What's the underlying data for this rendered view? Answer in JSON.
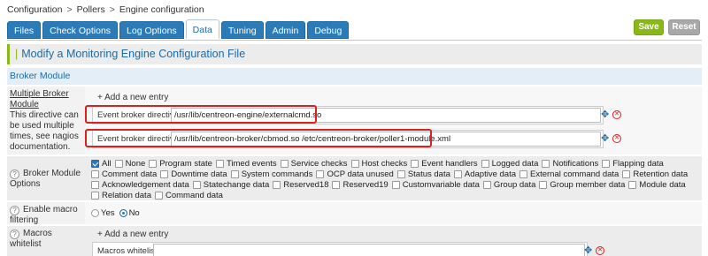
{
  "breadcrumb": [
    "Configuration",
    "Pollers",
    "Engine configuration"
  ],
  "breadcrumb_sep": ">",
  "tabs": [
    {
      "label": "Files",
      "active": false
    },
    {
      "label": "Check Options",
      "active": false
    },
    {
      "label": "Log Options",
      "active": false
    },
    {
      "label": "Data",
      "active": true
    },
    {
      "label": "Tuning",
      "active": false
    },
    {
      "label": "Admin",
      "active": false
    },
    {
      "label": "Debug",
      "active": false
    }
  ],
  "actions": {
    "save": "Save",
    "reset": "Reset"
  },
  "page_title": "Modify a Monitoring Engine Configuration File",
  "section": "Broker Module",
  "broker_module": {
    "label_title": "Multiple Broker Module",
    "label_desc": "This directive can be used multiple times, see nagios documentation.",
    "add_entry": "+ Add a new entry",
    "entries": [
      {
        "label": "Event broker directive",
        "value": "/usr/lib/centreon-engine/externalcmd.so"
      },
      {
        "label": "Event broker directive",
        "value": "/usr/lib/centreon-broker/cbmod.so /etc/centreon-broker/poller1-module.xml"
      }
    ]
  },
  "broker_options": {
    "label": "Broker Module Options",
    "help": "?",
    "lines": [
      [
        {
          "label": "All",
          "checked": true
        },
        {
          "label": "None",
          "checked": false
        },
        {
          "label": "Program state",
          "checked": false
        },
        {
          "label": "Timed events",
          "checked": false
        },
        {
          "label": "Service checks",
          "checked": false
        },
        {
          "label": "Host checks",
          "checked": false
        },
        {
          "label": "Event handlers",
          "checked": false
        },
        {
          "label": "Logged data",
          "checked": false
        },
        {
          "label": "Notifications",
          "checked": false
        },
        {
          "label": "Flapping data",
          "checked": false
        }
      ],
      [
        {
          "label": "Comment data",
          "checked": false
        },
        {
          "label": "Downtime data",
          "checked": false
        },
        {
          "label": "System commands",
          "checked": false
        },
        {
          "label": "OCP data unused",
          "checked": false
        },
        {
          "label": "Status data",
          "checked": false
        },
        {
          "label": "Adaptive data",
          "checked": false
        },
        {
          "label": "External command data",
          "checked": false
        },
        {
          "label": "Retention data",
          "checked": false
        }
      ],
      [
        {
          "label": "Acknowledgement data",
          "checked": false
        },
        {
          "label": "Statechange data",
          "checked": false
        },
        {
          "label": "Reserved18",
          "checked": false
        },
        {
          "label": "Reserved19",
          "checked": false
        },
        {
          "label": "Customvariable data",
          "checked": false
        },
        {
          "label": "Group data",
          "checked": false
        },
        {
          "label": "Group member data",
          "checked": false
        },
        {
          "label": "Module data",
          "checked": false
        }
      ],
      [
        {
          "label": "Relation data",
          "checked": false
        },
        {
          "label": "Command data",
          "checked": false
        }
      ]
    ]
  },
  "macro_filtering": {
    "label": "Enable macro filtering",
    "help": "?",
    "options": [
      {
        "label": "Yes",
        "selected": false
      },
      {
        "label": "No",
        "selected": true
      }
    ]
  },
  "macros_whitelist": {
    "label": "Macros whitelist",
    "help": "?",
    "add_entry": "+ Add a new entry",
    "field_label": "Macros whitelist",
    "value": ""
  }
}
